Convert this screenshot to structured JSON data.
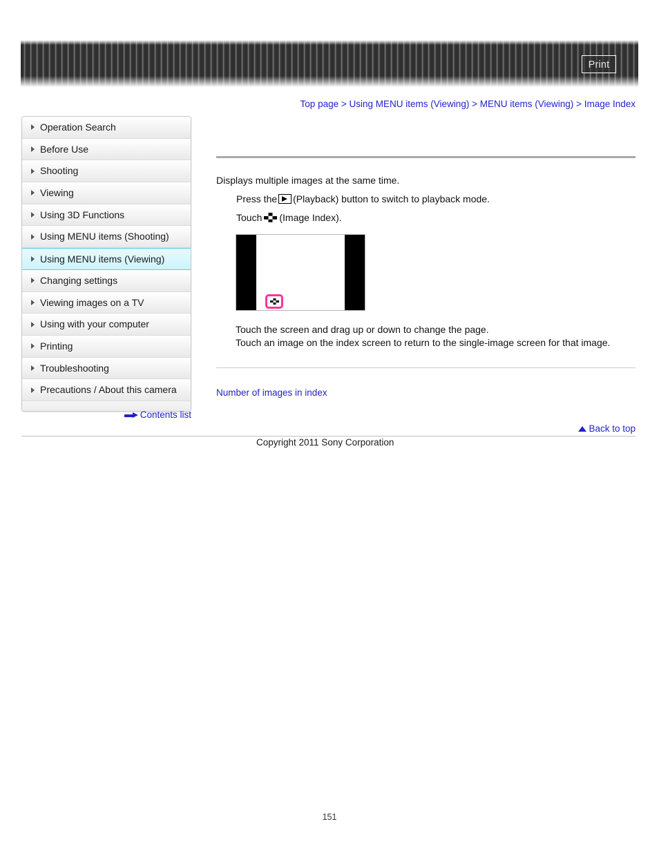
{
  "header": {
    "print_label": "Print",
    "print_icon": "printer-icon"
  },
  "breadcrumb": {
    "items": [
      "Top page",
      "Using MENU items (Viewing)",
      "MENU items (Viewing)",
      "Image Index"
    ],
    "separator": ">",
    "full_text": "Top page > Using MENU items (Viewing) > MENU items (Viewing) > Image Index",
    "link_color": "#2222cc"
  },
  "sidebar": {
    "items": [
      {
        "label": "Operation Search",
        "active": false
      },
      {
        "label": "Before Use",
        "active": false
      },
      {
        "label": "Shooting",
        "active": false
      },
      {
        "label": "Viewing",
        "active": false
      },
      {
        "label": "Using 3D Functions",
        "active": false
      },
      {
        "label": "Using MENU items (Shooting)",
        "active": false
      },
      {
        "label": "Using MENU items (Viewing)",
        "active": true
      },
      {
        "label": "Changing settings",
        "active": false
      },
      {
        "label": "Viewing images on a TV",
        "active": false
      },
      {
        "label": "Using with your computer",
        "active": false
      },
      {
        "label": "Printing",
        "active": false
      },
      {
        "label": "Troubleshooting",
        "active": false
      },
      {
        "label": "Precautions / About this camera",
        "active": false
      }
    ],
    "active_bg_color": "#cdf3fb",
    "contents_list_label": "Contents list"
  },
  "main": {
    "intro": "Displays multiple images at the same time.",
    "steps": [
      {
        "before": "Press the",
        "icon": "playback-icon",
        "after": "(Playback) button to switch to playback mode."
      },
      {
        "before": "Touch",
        "icon": "image-index-icon",
        "after": "(Image Index)."
      }
    ],
    "illustration": {
      "alt": "camera-screen-illustration",
      "highlight_color": "#ff3399",
      "highlighted_icon": "image-index-icon"
    },
    "notes": [
      "Touch the screen and drag up or down to change the page.",
      "Touch an image on the index screen to return to the single-image screen for that image."
    ],
    "related_link": "Number of images in index"
  },
  "footer": {
    "back_to_top": "Back to top",
    "copyright": "Copyright 2011 Sony Corporation",
    "page_number": "151"
  }
}
